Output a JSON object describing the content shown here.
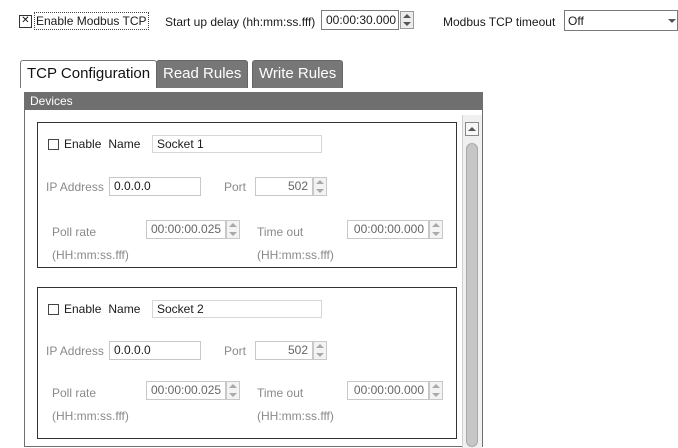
{
  "top_bar": {
    "enable_modbus_tcp": {
      "label": "Enable Modbus TCP",
      "checked": true,
      "mark": "✕"
    },
    "startup_delay": {
      "label": "Start up delay (hh:mm:ss.fff)",
      "value": "00:00:30.000"
    },
    "timeout": {
      "label": "Modbus TCP timeout",
      "value": "Off"
    }
  },
  "tabs": [
    {
      "label": "TCP Configuration",
      "active": true
    },
    {
      "label": "Read Rules",
      "active": false
    },
    {
      "label": "Write Rules",
      "active": false
    }
  ],
  "devices": {
    "title": "Devices",
    "sockets": [
      {
        "enable_label": "Enable",
        "name_label": "Name",
        "name_value": "Socket 1",
        "ip_label": "IP Address",
        "ip_value": "0.0.0.0",
        "port_label": "Port",
        "port_value": "502",
        "poll_label": "Poll rate",
        "poll_value": "00:00:00.025",
        "poll_format": "(HH:mm:ss.fff)",
        "timeout_label": "Time out",
        "timeout_value": "00:00:00.000",
        "timeout_format": "(HH:mm:ss.fff)"
      },
      {
        "enable_label": "Enable",
        "name_label": "Name",
        "name_value": "Socket 2",
        "ip_label": "IP Address",
        "ip_value": "0.0.0.0",
        "port_label": "Port",
        "port_value": "502",
        "poll_label": "Poll rate",
        "poll_value": "00:00:00.025",
        "poll_format": "(HH:mm:ss.fff)",
        "timeout_label": "Time out",
        "timeout_value": "00:00:00.000",
        "timeout_format": "(HH:mm:ss.fff)"
      }
    ]
  }
}
